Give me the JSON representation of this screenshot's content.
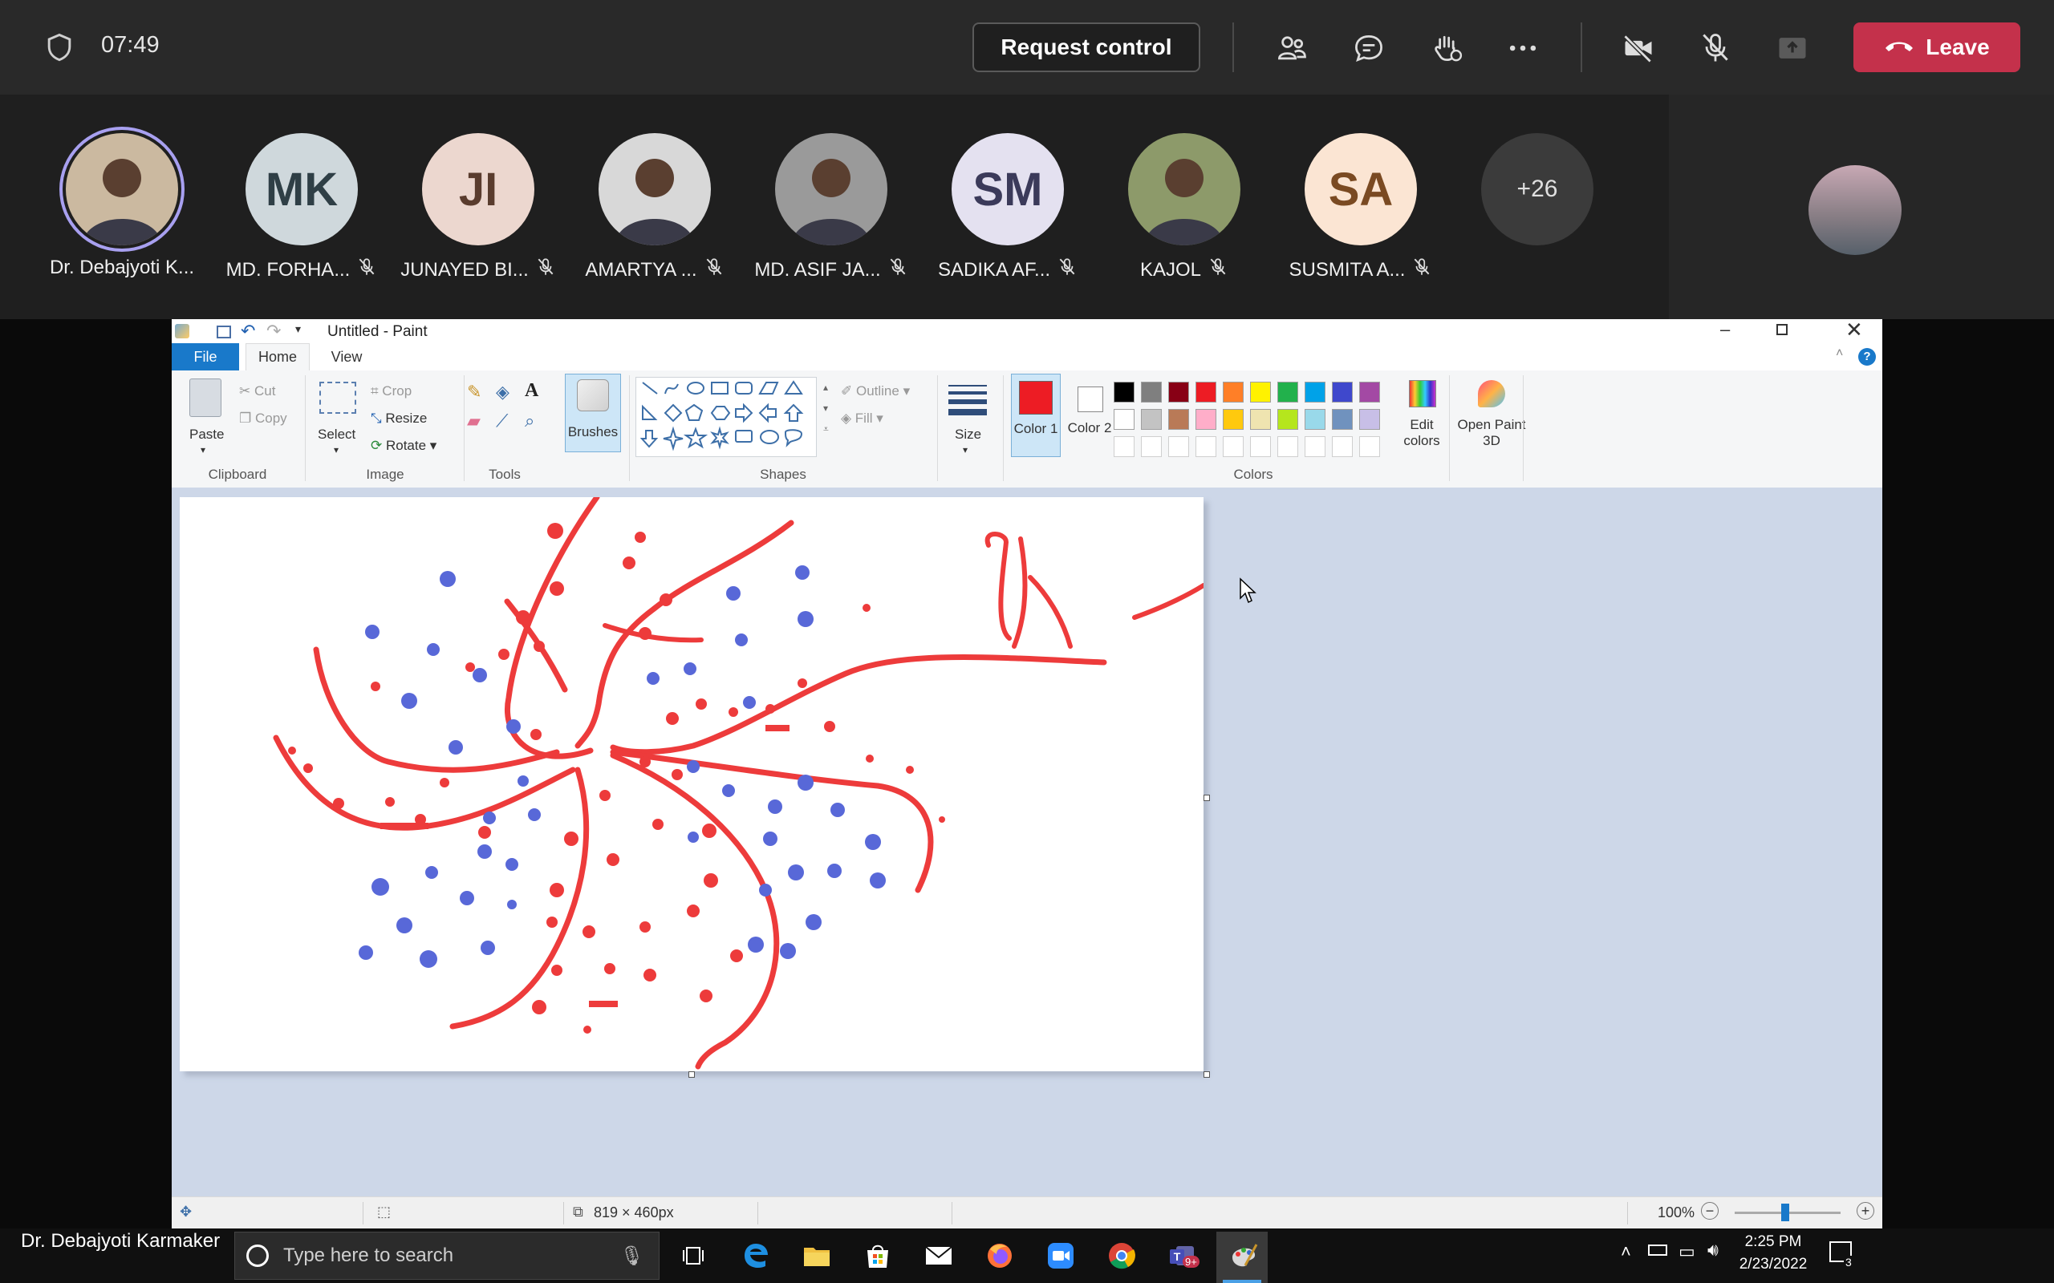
{
  "teams_bar": {
    "timer": "07:49",
    "request_control_label": "Request control",
    "leave_label": "Leave"
  },
  "participants": [
    {
      "initials": "",
      "name": "Dr. Debajyoti K...",
      "muted": false,
      "photo": true,
      "bg": "#cbb9a0"
    },
    {
      "initials": "MK",
      "name": "MD. FORHA...",
      "muted": true,
      "photo": false,
      "bg": "#cfd8dc",
      "fg": "#2f3f46"
    },
    {
      "initials": "JI",
      "name": "JUNAYED BI...",
      "muted": true,
      "photo": false,
      "bg": "#ecd7cf",
      "fg": "#5a3c2e"
    },
    {
      "initials": "",
      "name": "AMARTYA ...",
      "muted": true,
      "photo": true,
      "bg": "#d8d8d8"
    },
    {
      "initials": "",
      "name": "MD. ASIF JA...",
      "muted": true,
      "photo": true,
      "bg": "#9a9a9a"
    },
    {
      "initials": "SM",
      "name": "SADIKA AF...",
      "muted": true,
      "photo": false,
      "bg": "#e4e1f0",
      "fg": "#3b3a5a"
    },
    {
      "initials": "",
      "name": "KAJOL",
      "muted": true,
      "photo": true,
      "bg": "#8d9a6a"
    },
    {
      "initials": "SA",
      "name": "SUSMITA A...",
      "muted": true,
      "photo": false,
      "bg": "#fbe5d3",
      "fg": "#7a4a22"
    },
    {
      "initials": "+26",
      "name": "",
      "muted": false,
      "photo": false,
      "bg": "#3b3b3b",
      "fg": "#e0e0e0"
    }
  ],
  "paint": {
    "title": "Untitled - Paint",
    "tabs": [
      "File",
      "Home",
      "View"
    ],
    "clipboard": {
      "paste": "Paste",
      "cut": "Cut",
      "copy": "Copy",
      "group": "Clipboard"
    },
    "image": {
      "select": "Select",
      "crop": "Crop",
      "resize": "Resize",
      "rotate": "Rotate",
      "group": "Image"
    },
    "tools": {
      "group": "Tools",
      "brushes": "Brushes"
    },
    "shapes": {
      "outline": "Outline",
      "fill": "Fill",
      "group": "Shapes"
    },
    "size_label": "Size",
    "color1_label": "Color 1",
    "color2_label": "Color 2",
    "colors_group": "Colors",
    "edit_colors": "Edit colors",
    "open_paint3d": "Open Paint 3D",
    "palette_row1": [
      "#000000",
      "#7f7f7f",
      "#880015",
      "#ed1c24",
      "#ff7f27",
      "#fff200",
      "#22b14c",
      "#00a2e8",
      "#3f48cc",
      "#a349a4"
    ],
    "palette_row2": [
      "#ffffff",
      "#c3c3c3",
      "#b97a57",
      "#ffaec9",
      "#ffc90e",
      "#efe4b0",
      "#b5e61d",
      "#99d9ea",
      "#7092be",
      "#c8bfe7"
    ],
    "color1": "#ed1c24",
    "color2": "#ffffff",
    "status_size": "819 × 460px",
    "zoom": "100%"
  },
  "taskbar": {
    "presenter_name": "Dr. Debajyoti Karmaker",
    "search_placeholder": "Type here to search",
    "time": "2:25 PM",
    "date": "2/23/2022",
    "teams_badge": "9+",
    "notif_count": "3"
  }
}
